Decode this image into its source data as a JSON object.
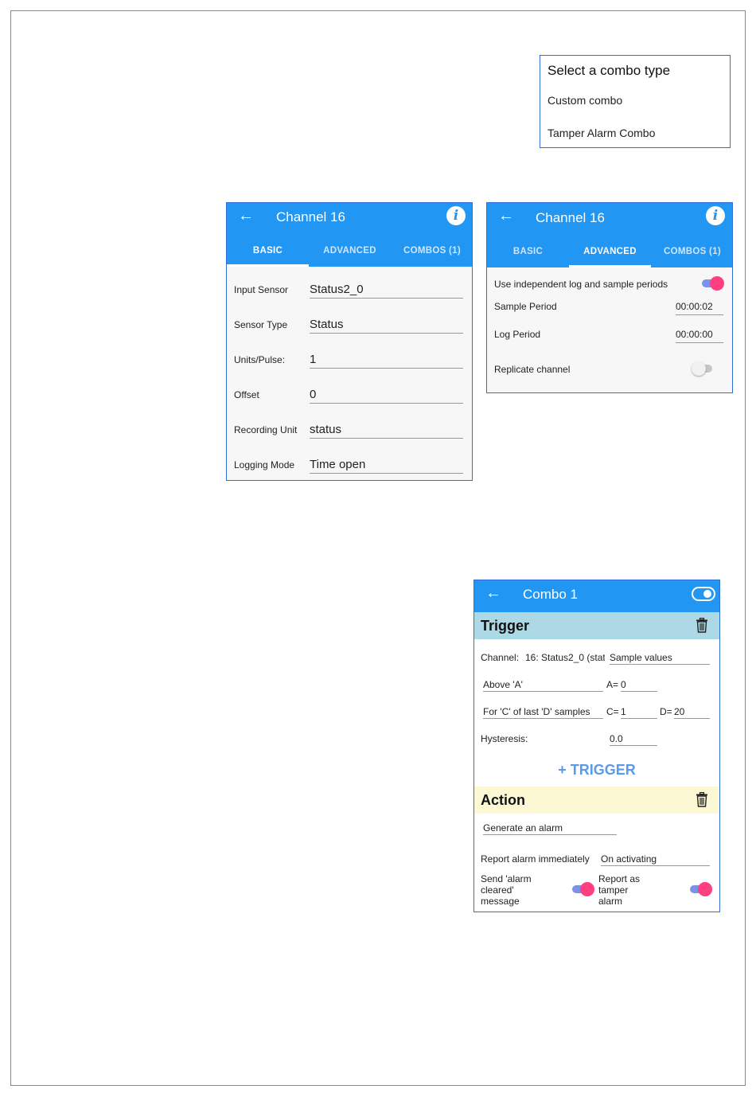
{
  "dialog": {
    "title": "Select a combo type",
    "items": [
      "Custom combo",
      "Tamper Alarm Combo"
    ]
  },
  "basic_panel": {
    "back_label": "←",
    "title": "Channel 16",
    "info_label": "i",
    "tabs": [
      "BASIC",
      "ADVANCED",
      "COMBOS (1)"
    ],
    "active_tab": "BASIC",
    "rows": [
      {
        "label": "Input Sensor",
        "value": "Status2_0"
      },
      {
        "label": "Sensor Type",
        "value": "Status"
      },
      {
        "label": "Units/Pulse:",
        "value": "1"
      },
      {
        "label": "Offset",
        "value": "0"
      },
      {
        "label": "Recording Unit",
        "value": "status"
      },
      {
        "label": "Logging Mode",
        "value": "Time open"
      }
    ]
  },
  "advanced_panel": {
    "back_label": "←",
    "title": "Channel 16",
    "info_label": "i",
    "tabs": [
      "BASIC",
      "ADVANCED",
      "COMBOS (1)"
    ],
    "active_tab": "ADVANCED",
    "independent_label": "Use independent log and sample periods",
    "independent_on": true,
    "sample_label": "Sample Period",
    "sample_value": "00:00:02",
    "log_label": "Log Period",
    "log_value": "00:00:00",
    "replicate_label": "Replicate channel",
    "replicate_on": false
  },
  "combo_panel": {
    "back_label": "←",
    "title": "Combo 1",
    "trigger": {
      "title": "Trigger",
      "channel_label": "Channel:",
      "channel_value": "16: Status2_0 (stat",
      "mode_value": "Sample values",
      "condition_value": "Above 'A'",
      "a_label": "A=",
      "a_value": "0",
      "count_value": "For 'C' of last 'D' samples",
      "c_label": "C=",
      "c_value": "1",
      "d_label": "D=",
      "d_value": "20",
      "hysteresis_label": "Hysteresis:",
      "hysteresis_value": "0.0",
      "add_label": "+ TRIGGER"
    },
    "action": {
      "title": "Action",
      "type_value": "Generate an alarm",
      "report_label": "Report alarm immediately",
      "report_value": "On activating",
      "cleared_label_1": "Send 'alarm",
      "cleared_label_2": "cleared'",
      "cleared_label_3": "message",
      "cleared_on": true,
      "tamper_label_1": "Report as",
      "tamper_label_2": "tamper",
      "tamper_label_3": "alarm",
      "tamper_on": true
    }
  },
  "colors": {
    "appbar": "#2196f3",
    "panel_border": "#2f6fd6",
    "trigger_header": "#add8e6",
    "action_header": "#fdf8d4",
    "switch_on_thumb": "#ff3f7f",
    "switch_on_track": "#7a92ea",
    "add_trigger": "#5b9ae6"
  }
}
